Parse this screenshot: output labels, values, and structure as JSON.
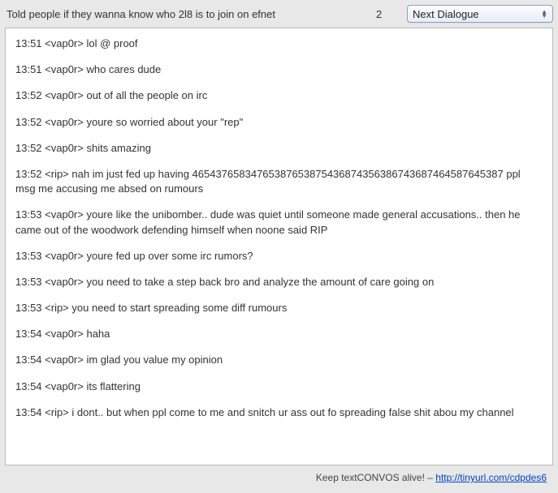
{
  "header": {
    "title": "Told people if they wanna know who 2l8 is to join on efnet",
    "count": "2",
    "dropdown_label": "Next Dialogue"
  },
  "chat": {
    "lines": [
      "13:51 <vap0r> lol @ proof",
      "13:51 <vap0r> who cares dude",
      "13:52 <vap0r> out of all the people on irc",
      "13:52 <vap0r> youre so worried about your \"rep\"",
      "13:52 <vap0r> shits amazing",
      "13:52 <rip> nah im just fed up having 465437658347653876538754368743563867436874645876453­87 ppl msg me accusing me absed on rumours",
      "13:53 <vap0r> youre like the unibomber.. dude was quiet until someone made general accusations.. then he came out of the woodwork defending himself when noone said RIP",
      "13:53 <vap0r> youre fed up over some irc rumors?",
      "13:53 <vap0r> you need to take a step back bro and analyze the amount of care going on",
      "13:53 <rip> you need to start spreading some diff rumours",
      "13:54 <vap0r> haha",
      "13:54 <vap0r> im glad you value my opinion",
      "13:54 <vap0r> its flattering",
      "13:54 <rip> i dont.. but when ppl come to me and snitch ur ass out fo spreading false shit abou my channel"
    ]
  },
  "footer": {
    "text": "Keep textCONVOS alive! – ",
    "link_text": "http://tinyurl.com/cdpdes6"
  }
}
